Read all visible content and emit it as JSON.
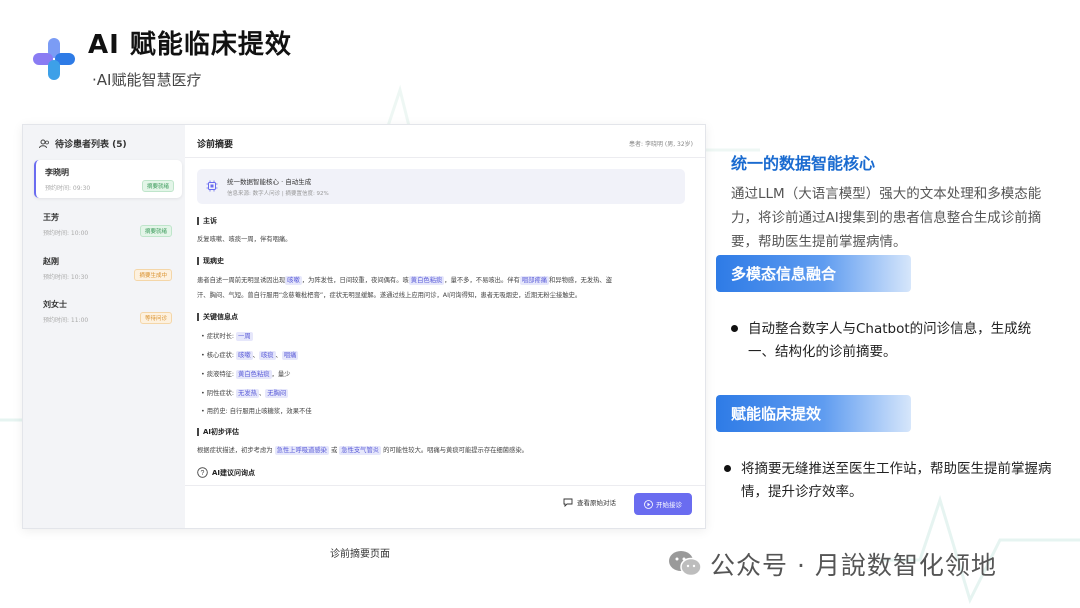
{
  "header": {
    "title": "AI 赋能临床提效",
    "subtitle": "·AI赋能智慧医疗"
  },
  "mockup": {
    "sidebar": {
      "title": "待诊患者列表 (5)",
      "patients": [
        {
          "name": "李晓明",
          "time": "预约时间: 09:30",
          "status": "摘要就绪",
          "status_color": "green"
        },
        {
          "name": "王芳",
          "time": "预约时间: 10:00",
          "status": "摘要就绪",
          "status_color": "green"
        },
        {
          "name": "赵刚",
          "time": "预约时间: 10:30",
          "status": "摘要生成中",
          "status_color": "orange"
        },
        {
          "name": "刘女士",
          "time": "预约时间: 11:00",
          "status": "等待问诊",
          "status_color": "orange"
        }
      ]
    },
    "main": {
      "title": "诊前摘要",
      "patient_info": "患者: 李晓明 (男, 32岁)",
      "info_box": {
        "title": "统一数据智能核心 · 自动生成",
        "subtitle": "信息来源: 数字人问诊 | 摘要置信度: 92%"
      },
      "chief_complaint": {
        "heading": "主诉",
        "text": "反复咳嗽、咳痰一周，伴有咽痛。"
      },
      "present_illness": {
        "heading": "现病史",
        "line1": [
          "患者自述一周前无明显诱因出现",
          "咳嗽",
          "，为阵发性，日间较重，夜间偶有。咳",
          "黄白色粘痰",
          "，量不多，不易咳出。伴有",
          "咽部疼痛",
          "和异物感，无发热、盗"
        ],
        "line2": "汗、胸闷、气短。曾自行服用“念慈菴枇杷膏”，症状无明显缓解。遂通过线上应用问诊，AI问询得知，患者无吸烟史，近期无粉尘接触史。"
      },
      "key_info": {
        "heading": "关键信息点",
        "items": [
          {
            "label": "症状时长:",
            "tags": [
              "一周"
            ],
            "suffix": ""
          },
          {
            "label": "核心症状:",
            "tags": [
              "咳嗽",
              "咳痰",
              "咽痛"
            ],
            "suffix": ""
          },
          {
            "label": "痰液特征:",
            "tags": [
              "黄白色粘痰"
            ],
            "suffix": "，量少"
          },
          {
            "label": "阴性症状:",
            "tags": [
              "无发热",
              "无胸闷"
            ],
            "suffix": ""
          },
          {
            "label": "用药史:",
            "tags": [],
            "suffix": "自行服用止咳糖浆，效果不佳"
          }
        ]
      },
      "ai_assessment": {
        "heading": "AI初步评估",
        "parts": [
          "根据症状描述，初步考虑为",
          "急性上呼吸道感染",
          "或",
          "急性支气管炎",
          "的可能性较大。咽痛与黄痰可能提示存在细菌感染。"
        ]
      },
      "suggest_heading": "AI建议问询点",
      "btn_chat": "查看原始对话",
      "btn_start": "开始接诊"
    },
    "caption": "诊前摘要页面"
  },
  "right": {
    "title": "统一的数据智能核心",
    "description": "通过LLM（大语言模型）强大的文本处理和多模态能力，将诊前通过AI搜集到的患者信息整合生成诊前摘要，帮助医生提前掌握病情。",
    "section1": {
      "banner": "多模态信息融合",
      "bullet": "自动整合数字人与Chatbot的问诊信息，生成统一、结构化的诊前摘要。"
    },
    "section2": {
      "banner": "赋能临床提效",
      "bullet": "将摘要无缝推送至医生工作站，帮助医生提前掌握病情，提升诊疗效率。"
    }
  },
  "watermark": "公众号 · 月說数智化领地",
  "colors": {
    "accent_blue": "#1a6bd0",
    "accent_purple": "#6a6cf0",
    "logo_blue": "#2e7be6",
    "logo_purple": "#8a7cf3"
  }
}
